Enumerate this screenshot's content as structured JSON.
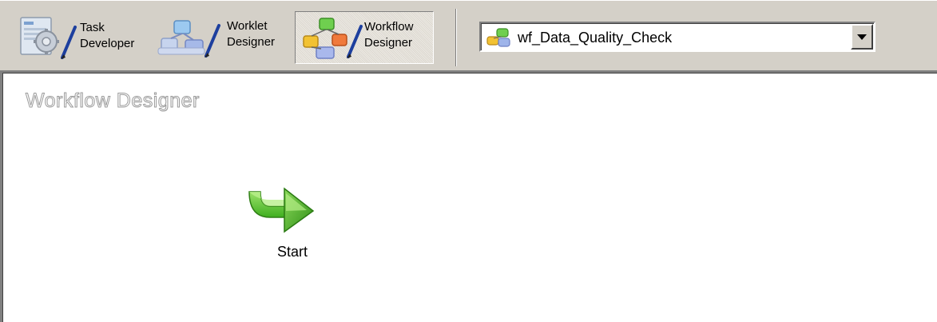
{
  "toolbar": {
    "task_developer": {
      "line1": "Task",
      "line2": "Developer",
      "icon": "task-developer-icon"
    },
    "worklet_designer": {
      "line1": "Worklet",
      "line2": "Designer",
      "icon": "worklet-designer-icon"
    },
    "workflow_designer": {
      "line1": "Workflow",
      "line2": "Designer",
      "icon": "workflow-designer-icon",
      "active": true
    }
  },
  "workflow_selector": {
    "value": "wf_Data_Quality_Check",
    "icon": "workflow-icon"
  },
  "canvas": {
    "title": "Workflow Designer",
    "nodes": [
      {
        "label": "Start",
        "icon": "start-arrow-icon"
      }
    ]
  },
  "colors": {
    "toolbar_bg": "#d4d0c8",
    "canvas_bg": "#ffffff",
    "start_green": "#3fae1f"
  }
}
